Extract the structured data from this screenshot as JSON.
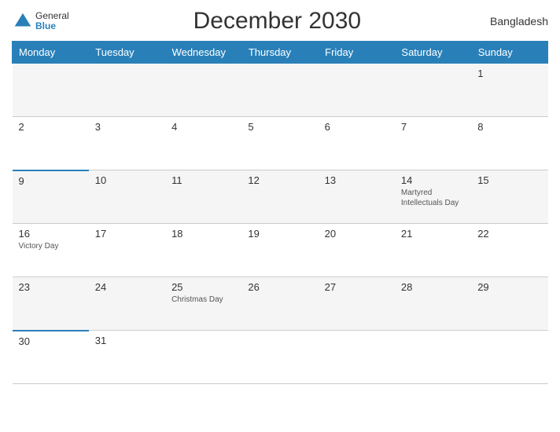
{
  "header": {
    "title": "December 2030",
    "country": "Bangladesh",
    "logo": {
      "general": "General",
      "blue": "Blue"
    }
  },
  "weekdays": [
    "Monday",
    "Tuesday",
    "Wednesday",
    "Thursday",
    "Friday",
    "Saturday",
    "Sunday"
  ],
  "weeks": [
    [
      {
        "day": "",
        "holiday": ""
      },
      {
        "day": "",
        "holiday": ""
      },
      {
        "day": "",
        "holiday": ""
      },
      {
        "day": "",
        "holiday": ""
      },
      {
        "day": "",
        "holiday": ""
      },
      {
        "day": "",
        "holiday": ""
      },
      {
        "day": "1",
        "holiday": ""
      }
    ],
    [
      {
        "day": "2",
        "holiday": ""
      },
      {
        "day": "3",
        "holiday": ""
      },
      {
        "day": "4",
        "holiday": ""
      },
      {
        "day": "5",
        "holiday": ""
      },
      {
        "day": "6",
        "holiday": ""
      },
      {
        "day": "7",
        "holiday": ""
      },
      {
        "day": "8",
        "holiday": ""
      }
    ],
    [
      {
        "day": "9",
        "holiday": "",
        "blueTop": true
      },
      {
        "day": "10",
        "holiday": ""
      },
      {
        "day": "11",
        "holiday": ""
      },
      {
        "day": "12",
        "holiday": ""
      },
      {
        "day": "13",
        "holiday": ""
      },
      {
        "day": "14",
        "holiday": "Martyred Intellectuals Day"
      },
      {
        "day": "15",
        "holiday": ""
      }
    ],
    [
      {
        "day": "16",
        "holiday": "Victory Day"
      },
      {
        "day": "17",
        "holiday": ""
      },
      {
        "day": "18",
        "holiday": ""
      },
      {
        "day": "19",
        "holiday": ""
      },
      {
        "day": "20",
        "holiday": ""
      },
      {
        "day": "21",
        "holiday": ""
      },
      {
        "day": "22",
        "holiday": ""
      }
    ],
    [
      {
        "day": "23",
        "holiday": ""
      },
      {
        "day": "24",
        "holiday": ""
      },
      {
        "day": "25",
        "holiday": "Christmas Day"
      },
      {
        "day": "26",
        "holiday": ""
      },
      {
        "day": "27",
        "holiday": ""
      },
      {
        "day": "28",
        "holiday": ""
      },
      {
        "day": "29",
        "holiday": ""
      }
    ],
    [
      {
        "day": "30",
        "holiday": "",
        "blueTop": true
      },
      {
        "day": "31",
        "holiday": ""
      },
      {
        "day": "",
        "holiday": ""
      },
      {
        "day": "",
        "holiday": ""
      },
      {
        "day": "",
        "holiday": ""
      },
      {
        "day": "",
        "holiday": ""
      },
      {
        "day": "",
        "holiday": ""
      }
    ]
  ]
}
